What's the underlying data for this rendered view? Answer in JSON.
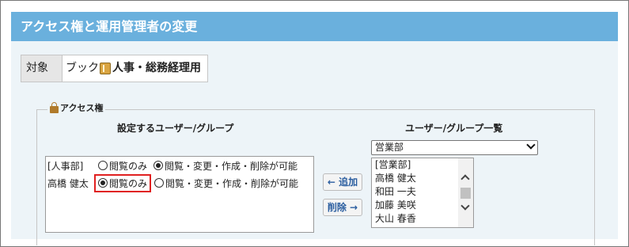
{
  "title": "アクセス権と運用管理者の変更",
  "target": {
    "label": "対象",
    "prefix": "ブック",
    "name": "人事・総務経理用"
  },
  "access_section": {
    "legend": "アクセス権",
    "left_header": "設定するユーザー/グループ",
    "right_header": "ユーザー/グループ一覧",
    "members": [
      {
        "name": "[人事部]",
        "opt1": "閲覧のみ",
        "opt2": "閲覧・変更・作成・削除が可能",
        "selected": 2
      },
      {
        "name": "高橋 健太",
        "opt1": "閲覧のみ",
        "opt2": "閲覧・変更・作成・削除が可能",
        "selected": 1
      }
    ],
    "add_button": "← 追加",
    "delete_button": "削除 →",
    "group_select": "営業部",
    "user_list": [
      "[営業部]",
      "高橋 健太",
      "和田 一夫",
      "加藤 美咲",
      "大山 春香"
    ]
  },
  "colors": {
    "title_bar": "#6ab0dd",
    "panel_bg": "#edf4f8",
    "highlight": "#e02020"
  }
}
